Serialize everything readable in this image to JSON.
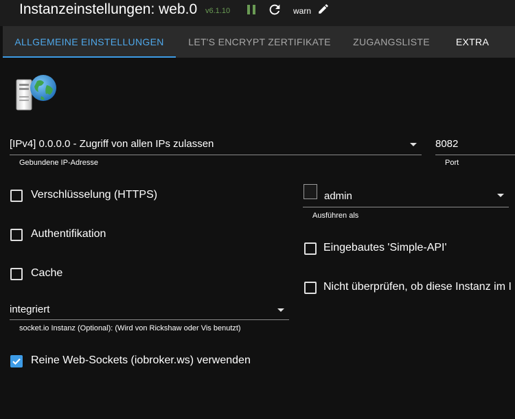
{
  "header": {
    "title": "Instanzeinstellungen: web.0",
    "version": "v6.1.10",
    "loglevel": "warn"
  },
  "tabs": [
    {
      "label": "ALLGEMEINE EINSTELLUNGEN"
    },
    {
      "label": "LET'S ENCRYPT ZERTIFIKATE"
    },
    {
      "label": "ZUGANGSLISTE"
    },
    {
      "label": "EXTRA"
    }
  ],
  "form": {
    "bind_ip": {
      "value": "[IPv4] 0.0.0.0 - Zugriff von allen IPs zulassen",
      "label": "Gebundene IP-Adresse"
    },
    "port": {
      "value": "8082",
      "label": "Port"
    },
    "https": {
      "label": "Verschlüsselung (HTTPS)",
      "checked": false
    },
    "auth": {
      "label": "Authentifikation",
      "checked": false
    },
    "cache": {
      "label": "Cache",
      "checked": false
    },
    "run_as": {
      "value": "admin",
      "label": "Ausführen als"
    },
    "simple_api": {
      "label": "Eingebautes 'Simple-API'",
      "checked": false
    },
    "no_check": {
      "label": "Nicht überprüfen, ob diese Instanz im I",
      "checked": false
    },
    "socketio": {
      "value": "integriert",
      "label": "socket.io Instanz (Optional): (Wird von Rickshaw oder Vis benutzt)"
    },
    "pure_ws": {
      "label": "Reine Web-Sockets (iobroker.ws) verwenden",
      "checked": true
    }
  },
  "colors": {
    "accent": "#3d9be6",
    "running": "#6a9b54",
    "background": "#111111",
    "tabbar": "#2b2b2b"
  }
}
